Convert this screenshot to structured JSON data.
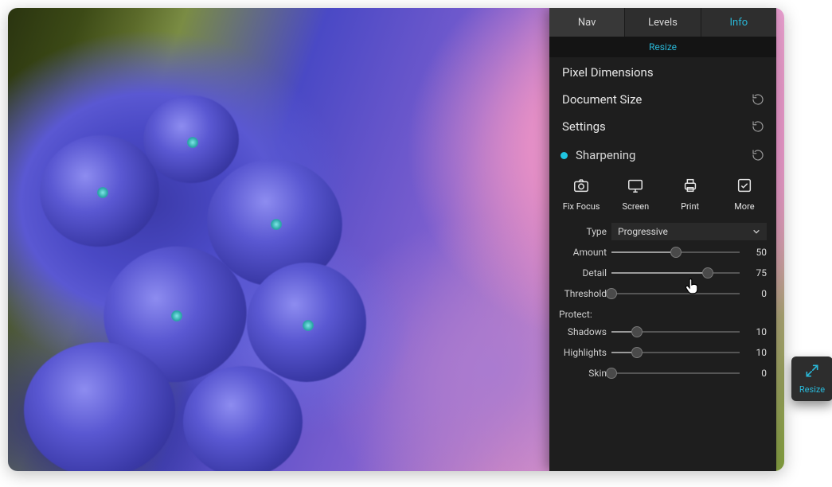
{
  "panel": {
    "tabs": {
      "nav": "Nav",
      "levels": "Levels",
      "info": "Info",
      "active": "info"
    },
    "resize_header": "Resize",
    "sections": {
      "pixel_dimensions": "Pixel Dimensions",
      "document_size": "Document Size",
      "settings": "Settings",
      "sharpening": "Sharpening"
    },
    "preset_buttons": {
      "fix_focus": "Fix Focus",
      "screen": "Screen",
      "print": "Print",
      "more": "More"
    },
    "type": {
      "label": "Type",
      "value": "Progressive"
    },
    "sliders": {
      "amount": {
        "label": "Amount",
        "value": 50,
        "max": 100
      },
      "detail": {
        "label": "Detail",
        "value": 75,
        "max": 100
      },
      "threshold": {
        "label": "Threshold",
        "value": 0,
        "max": 100
      }
    },
    "protect": {
      "label": "Protect:",
      "shadows": {
        "label": "Shadows",
        "value": 10,
        "max": 50
      },
      "highlights": {
        "label": "Highlights",
        "value": 10,
        "max": 50
      },
      "skin": {
        "label": "Skin",
        "value": 0,
        "max": 50
      }
    }
  },
  "float_button": {
    "label": "Resize"
  },
  "colors": {
    "accent": "#29b8d8",
    "panel_bg": "#1e1e1e"
  }
}
